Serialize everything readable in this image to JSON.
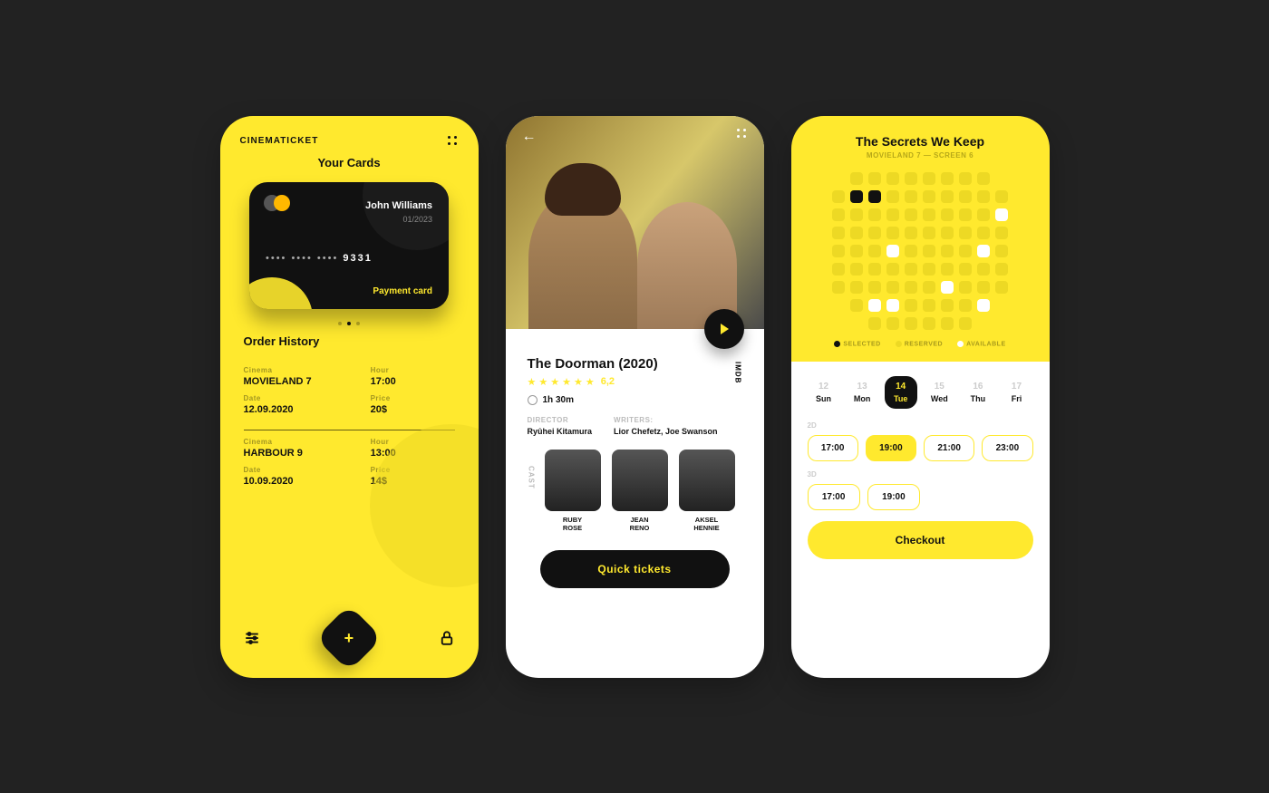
{
  "left": {
    "brand": "CINEMATICKET",
    "cards_title": "Your Cards",
    "card": {
      "holder": "John Williams",
      "expiry": "01/2023",
      "number_masked": "•••• •••• ••••",
      "number_last": "9331",
      "type": "Payment card"
    },
    "history_title": "Order History",
    "orders": [
      {
        "cinema_lbl": "Cinema",
        "cinema": "MOVIELAND 7",
        "hour_lbl": "Hour",
        "hour": "17:00",
        "date_lbl": "Date",
        "date": "12.09.2020",
        "price_lbl": "Price",
        "price": "20$"
      },
      {
        "cinema_lbl": "Cinema",
        "cinema": "HARBOUR 9",
        "hour_lbl": "Hour",
        "hour": "13:00",
        "date_lbl": "Date",
        "date": "10.09.2020",
        "price_lbl": "Price",
        "price": "14$"
      }
    ]
  },
  "mid": {
    "title": "The Doorman (2020)",
    "rating": "6,2",
    "runtime": "1h 30m",
    "director_lbl": "DIRECTOR",
    "director": "Ryûhei Kitamura",
    "writers_lbl": "WRITERS:",
    "writers": "Lior Chefetz, Joe Swanson",
    "imdb": "IMDB",
    "cast_lbl": "CAST",
    "cast": [
      {
        "name": "RUBY ROSE"
      },
      {
        "name": "JEAN RENO"
      },
      {
        "name": "AKSEL HENNIE"
      }
    ],
    "quick": "Quick tickets"
  },
  "right": {
    "title": "The Secrets We Keep",
    "subtitle": "MOVIELAND 7 — SCREEN 6",
    "legend": {
      "selected": "SELECTED",
      "reserved": "RESERVED",
      "available": "AVAILABLE"
    },
    "seat_rows": [
      "sp,r,r,r,r,r,r,r,r,sp",
      "r,s,s,r,r,r,r,r,r,r",
      "r,r,r,r,r,r,r,r,r,a",
      "r,r,r,r,r,r,r,r,r,r",
      "r,r,r,a,r,r,r,r,a,r",
      "r,r,r,r,r,r,r,r,r,r",
      "r,r,r,r,r,r,a,r,r,r",
      "sp,r,a,a,r,r,r,r,a,sp",
      "sp,sp,r,r,r,r,r,r,sp,sp"
    ],
    "dates": [
      {
        "num": "12",
        "day": "Sun"
      },
      {
        "num": "13",
        "day": "Mon"
      },
      {
        "num": "14",
        "day": "Tue",
        "selected": true
      },
      {
        "num": "15",
        "day": "Wed"
      },
      {
        "num": "16",
        "day": "Thu"
      },
      {
        "num": "17",
        "day": "Fri"
      }
    ],
    "section_2d": "2D",
    "slots_2d": [
      {
        "t": "17:00"
      },
      {
        "t": "19:00",
        "selected": true
      },
      {
        "t": "21:00"
      },
      {
        "t": "23:00"
      }
    ],
    "section_3d": "3D",
    "slots_3d": [
      {
        "t": "17:00"
      },
      {
        "t": "19:00"
      }
    ],
    "checkout": "Checkout"
  }
}
